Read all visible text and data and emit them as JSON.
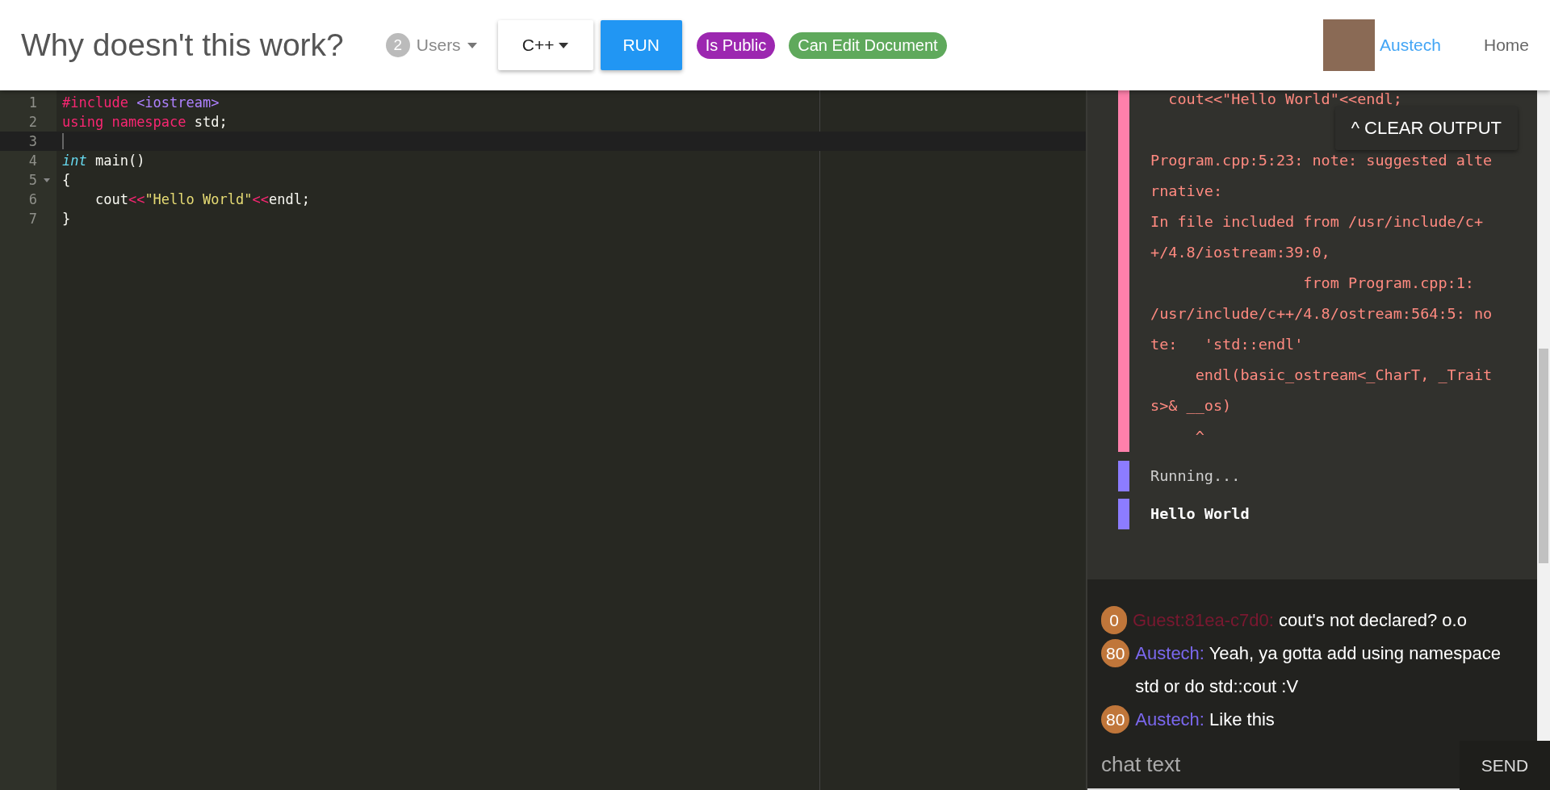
{
  "header": {
    "title": "Why doesn't this work?",
    "users": {
      "count": "2",
      "label": "Users"
    },
    "language": "C++",
    "run": "RUN",
    "badges": [
      {
        "label": "Is Public",
        "color": "#9c27b0"
      },
      {
        "label": "Can Edit Document",
        "color": "#5fa95c"
      }
    ],
    "user": "Austech",
    "home": "Home"
  },
  "editor": {
    "lines": [
      {
        "number": "1",
        "active": false,
        "foldable": false,
        "tokens": [
          {
            "text": "#include ",
            "kind": "keyword"
          },
          {
            "text": "<iostream>",
            "kind": "include"
          }
        ]
      },
      {
        "number": "2",
        "active": false,
        "foldable": false,
        "tokens": [
          {
            "text": "using",
            "kind": "keyword"
          },
          {
            "text": " namespace",
            "kind": "keyword"
          },
          {
            "text": " std;",
            "kind": "plain"
          }
        ]
      },
      {
        "number": "3",
        "active": true,
        "foldable": false
      },
      {
        "number": "4",
        "active": false,
        "foldable": false,
        "tokens": [
          {
            "text": "int",
            "kind": "type"
          },
          {
            "text": " main()",
            "kind": "plain"
          }
        ]
      },
      {
        "number": "5",
        "active": false,
        "foldable": true,
        "tokens": [
          {
            "text": "{",
            "kind": "plain"
          }
        ]
      },
      {
        "number": "6",
        "active": false,
        "foldable": false,
        "tokens": [
          {
            "text": "    cout",
            "kind": "plain"
          },
          {
            "text": "<<",
            "kind": "keyword"
          },
          {
            "text": "\"Hello World\"",
            "kind": "string"
          },
          {
            "text": "<<",
            "kind": "keyword"
          },
          {
            "text": "endl;",
            "kind": "plain"
          }
        ]
      },
      {
        "number": "7",
        "active": false,
        "foldable": false,
        "tokens": [
          {
            "text": "}",
            "kind": "plain"
          }
        ]
      }
    ]
  },
  "output": {
    "clear_button": "^ CLEAR OUTPUT",
    "blocks": [
      {
        "kind": "error",
        "lines": [
          "  cout<<\"Hello World\"<<endl;",
          "Program.cpp:5:23: note: suggested alte",
          "rnative:",
          "In file included from /usr/include/c+",
          "+/4.8/iostream:39:0,",
          "                 from Program.cpp:1:",
          "/usr/include/c++/4.8/ostream:564:5: no",
          "te:   'std::endl'",
          "     endl(basic_ostream<_CharT, _Trait",
          "s>& __os)",
          "     ^"
        ]
      },
      {
        "kind": "status",
        "lines": [
          "Running..."
        ]
      },
      {
        "kind": "result",
        "lines": [
          "Hello World"
        ]
      }
    ]
  },
  "chat": {
    "messages": [
      {
        "score": "0",
        "user": "Guest:81ea-c7d0:",
        "color": "#7a1830",
        "text": "cout's not declared? o.o"
      },
      {
        "score": "80",
        "user": "Austech:",
        "color": "#7b68ee",
        "text": "Yeah, ya gotta add using namespace std or do std::cout :V"
      },
      {
        "score": "80",
        "user": "Austech:",
        "color": "#7b68ee",
        "text": "Like this"
      }
    ],
    "input": {
      "placeholder": "chat text"
    },
    "send": "SEND"
  }
}
